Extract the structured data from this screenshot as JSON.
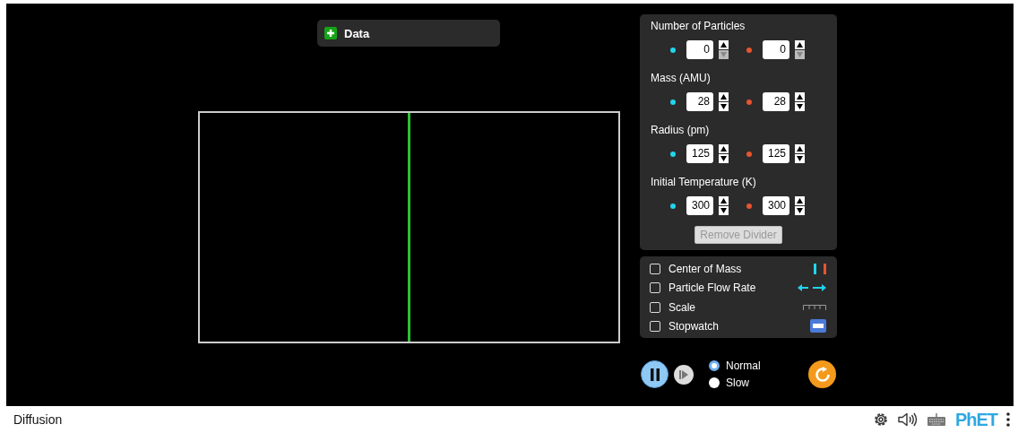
{
  "data_panel": {
    "label": "Data",
    "expanded": false
  },
  "container": {
    "divider": true
  },
  "parameters": [
    {
      "label": "Number of Particles",
      "values": [
        {
          "value": "0",
          "color": "#22d3ee",
          "down_enabled": false
        },
        {
          "value": "0",
          "color": "#e8542f",
          "down_enabled": false
        }
      ]
    },
    {
      "label": "Mass (AMU)",
      "values": [
        {
          "value": "28",
          "color": "#22d3ee",
          "down_enabled": true
        },
        {
          "value": "28",
          "color": "#e8542f",
          "down_enabled": true
        }
      ]
    },
    {
      "label": "Radius (pm)",
      "values": [
        {
          "value": "125",
          "color": "#22d3ee",
          "down_enabled": true
        },
        {
          "value": "125",
          "color": "#e8542f",
          "down_enabled": true
        }
      ]
    },
    {
      "label": "Initial Temperature (K)",
      "values": [
        {
          "value": "300",
          "color": "#22d3ee",
          "down_enabled": true
        },
        {
          "value": "300",
          "color": "#e8542f",
          "down_enabled": true
        }
      ]
    }
  ],
  "remove_divider": {
    "label": "Remove Divider",
    "disabled": true
  },
  "options": [
    {
      "label": "Center of Mass",
      "checked": false,
      "kind": "mass"
    },
    {
      "label": "Particle Flow Rate",
      "checked": false,
      "kind": "flow"
    },
    {
      "label": "Scale",
      "checked": false,
      "kind": "scale"
    },
    {
      "label": "Stopwatch",
      "checked": false,
      "kind": "stopwatch"
    }
  ],
  "playing": true,
  "speeds": [
    {
      "label": "Normal",
      "selected": true
    },
    {
      "label": "Slow",
      "selected": false
    }
  ],
  "footer": {
    "title": "Diffusion",
    "logo": "PhET"
  }
}
